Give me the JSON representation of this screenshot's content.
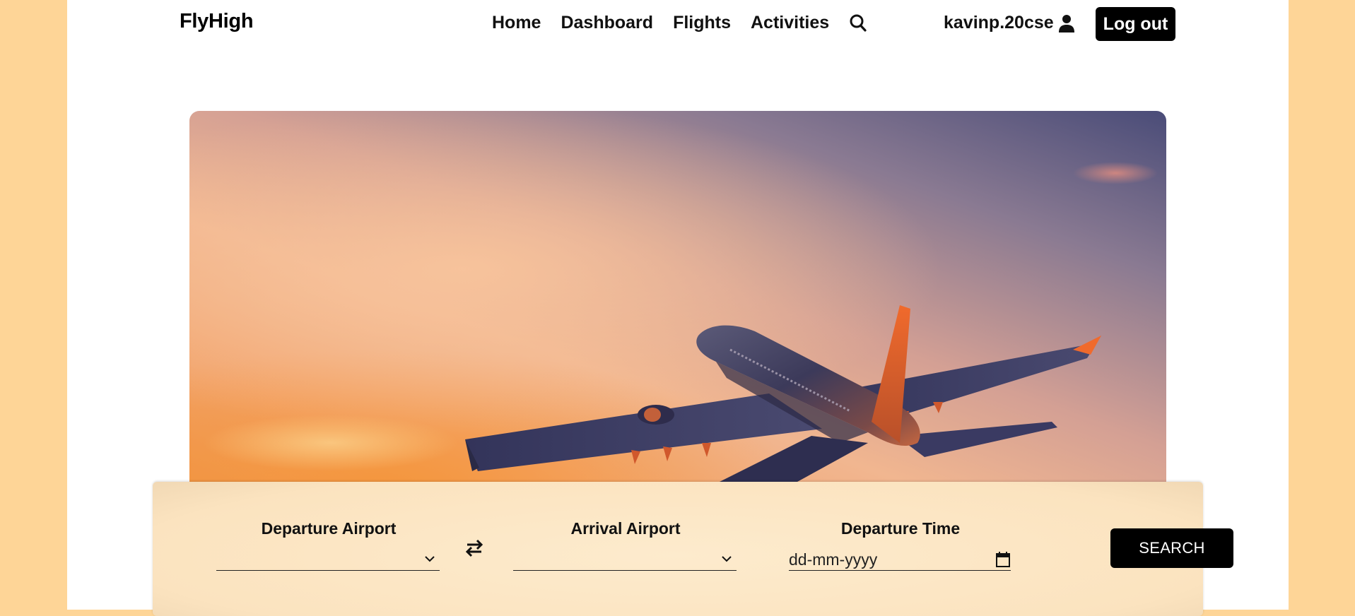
{
  "brand": "FlyHigh",
  "nav": {
    "items": [
      {
        "label": "Home"
      },
      {
        "label": "Dashboard"
      },
      {
        "label": "Flights"
      },
      {
        "label": "Activities"
      }
    ],
    "search_icon": "search-icon"
  },
  "user": {
    "username": "kavinp.20cse",
    "icon": "user-icon",
    "logout_label": "Log out"
  },
  "hero": {
    "image": "airplane-sunset"
  },
  "search_form": {
    "departure_airport": {
      "label": "Departure Airport",
      "value": ""
    },
    "swap_icon": "swap-arrows-icon",
    "arrival_airport": {
      "label": "Arrival Airport",
      "value": ""
    },
    "departure_time": {
      "label": "Departure Time",
      "placeholder": "dd-mm-yyyy",
      "icon": "calendar-icon"
    },
    "search_label": "SEARCH"
  },
  "colors": {
    "page_background": "#fed597",
    "panel_background": "#fbe3bf",
    "button": "#000000",
    "button_text": "#ffffff"
  }
}
